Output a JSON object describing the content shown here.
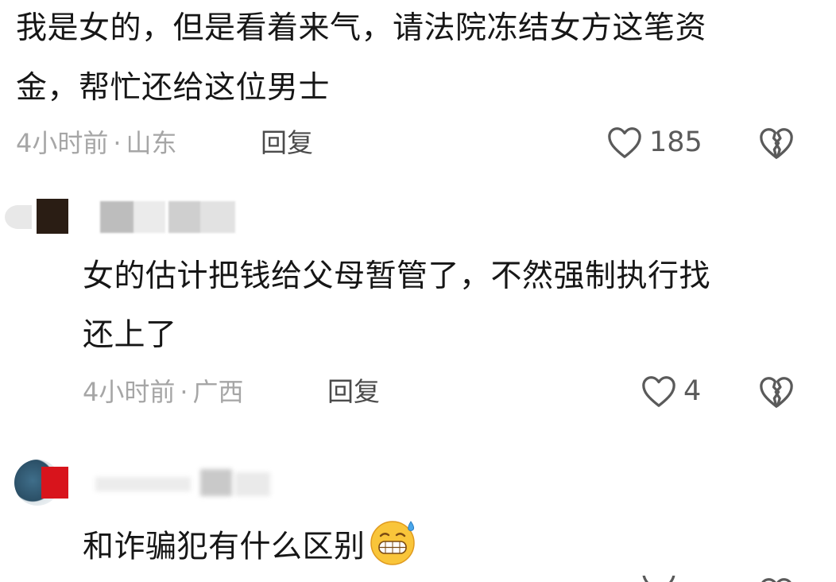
{
  "comments": [
    {
      "text_line1": "我是女的，但是看着来气，请法院冻结女方这笔资",
      "text_line2": "金，帮忙还给这位男士",
      "time": "4小时前",
      "separator": "·",
      "location": "山东",
      "reply_label": "回复",
      "like_count": "185"
    },
    {
      "text_line1": "女的估计把钱给父母暂管了，不然强制执行找",
      "text_line2": "还上了",
      "time": "4小时前",
      "separator": "·",
      "location": "广西",
      "reply_label": "回复",
      "like_count": "4"
    },
    {
      "text_line1": "和诈骗犯有什么区别",
      "emoji": "grinning-sweat-emoji"
    }
  ],
  "icons": {
    "like": "heart-outline-icon",
    "dislike": "broken-heart-icon"
  },
  "colors": {
    "text": "#161616",
    "meta": "#a6a6a6",
    "reply": "#4b4b4b",
    "icon": "#5a5a5a"
  }
}
